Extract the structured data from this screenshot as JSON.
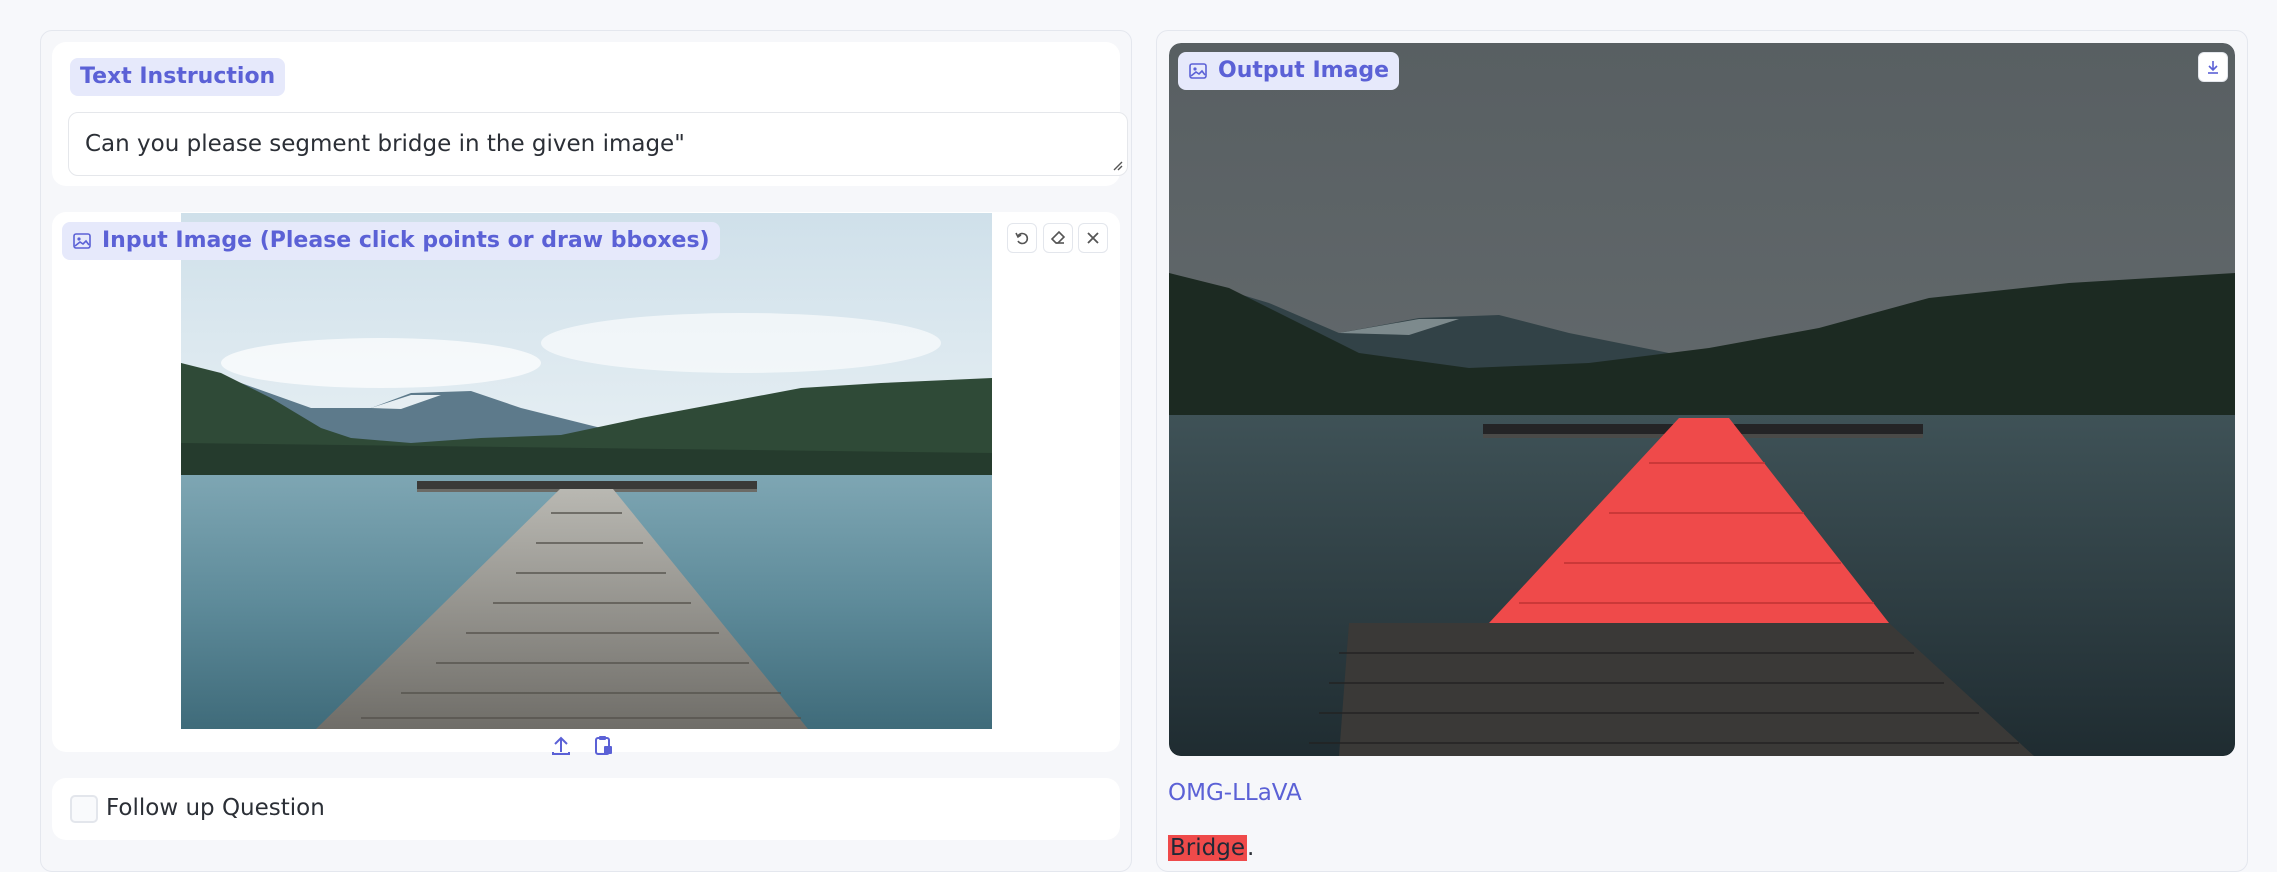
{
  "text_instruction": {
    "label": "Text Instruction",
    "value": "Can you please segment bridge in the given image\""
  },
  "input_image": {
    "label": "Input Image (Please click points or draw bboxes)",
    "tools": [
      "undo-icon",
      "eraser-icon",
      "close-icon"
    ],
    "bottom_tools": [
      "upload-icon",
      "clipboard-icon"
    ]
  },
  "follow_up": {
    "label": "Follow up Question",
    "checked": false
  },
  "output_image": {
    "label": "Output Image",
    "download_icon": "download-icon"
  },
  "result": {
    "model_name": "OMG-LLaVA",
    "answer_word": "Bridge",
    "answer_suffix": ".",
    "highlight_color": "#ef4a4a"
  },
  "colors": {
    "accent": "#5b61d6",
    "chip_bg": "#e6e9fb",
    "background": "#f7f8fb"
  }
}
